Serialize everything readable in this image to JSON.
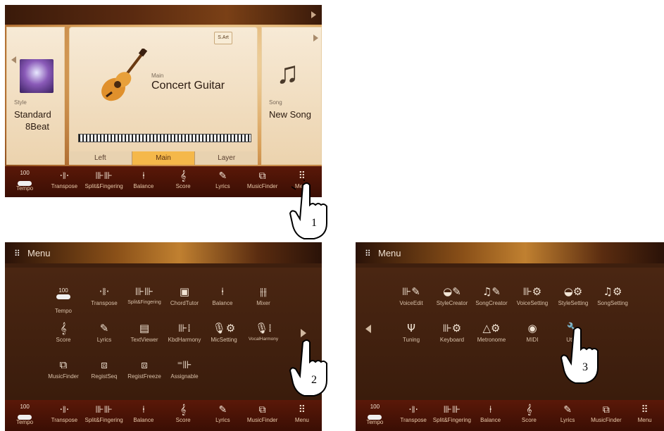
{
  "screen1": {
    "style": {
      "caption": "Style",
      "name_line1": "Standard",
      "name_line2": "8Beat"
    },
    "main": {
      "caption": "Main",
      "name": "Concert Guitar",
      "sart_label": "S.Art"
    },
    "song": {
      "caption": "Song",
      "name": "New Song"
    },
    "part_tabs": [
      "Left",
      "Main",
      "Layer"
    ],
    "bottom": {
      "tempo_value": "100",
      "labels": [
        "Tempo",
        "Transpose",
        "Split&Fingering",
        "Balance",
        "Score",
        "Lyrics",
        "MusicFinder",
        "Menu"
      ]
    },
    "step": "1"
  },
  "screen2": {
    "title": "Menu",
    "row1": [
      "Tempo",
      "Transpose",
      "Split&Fingering",
      "ChordTutor",
      "Balance",
      "Mixer"
    ],
    "row2": [
      "Score",
      "Lyrics",
      "TextViewer",
      "KbdHarmony",
      "MicSetting",
      "VocalHarmony"
    ],
    "row3": [
      "MusicFinder",
      "RegistSeq",
      "RegistFreeze",
      "Assignable"
    ],
    "tempo_value": "100",
    "bottom_labels": [
      "Tempo",
      "Transpose",
      "Split&Fingering",
      "Balance",
      "Score",
      "Lyrics",
      "MusicFinder",
      "Menu"
    ],
    "step": "2"
  },
  "screen3": {
    "title": "Menu",
    "row1": [
      "VoiceEdit",
      "StyleCreator",
      "SongCreator",
      "VoiceSetting",
      "StyleSetting",
      "SongSetting"
    ],
    "row2": [
      "Tuning",
      "Keyboard",
      "Metronome",
      "MIDI",
      "Utility"
    ],
    "tempo_value": "100",
    "bottom_labels": [
      "Tempo",
      "Transpose",
      "Split&Fingering",
      "Balance",
      "Score",
      "Lyrics",
      "MusicFinder",
      "Menu"
    ],
    "step": "3"
  },
  "colors": {
    "accent": "#f5b84a",
    "bar": "#3a0e04",
    "menu_bg": "#3e1f0e"
  }
}
